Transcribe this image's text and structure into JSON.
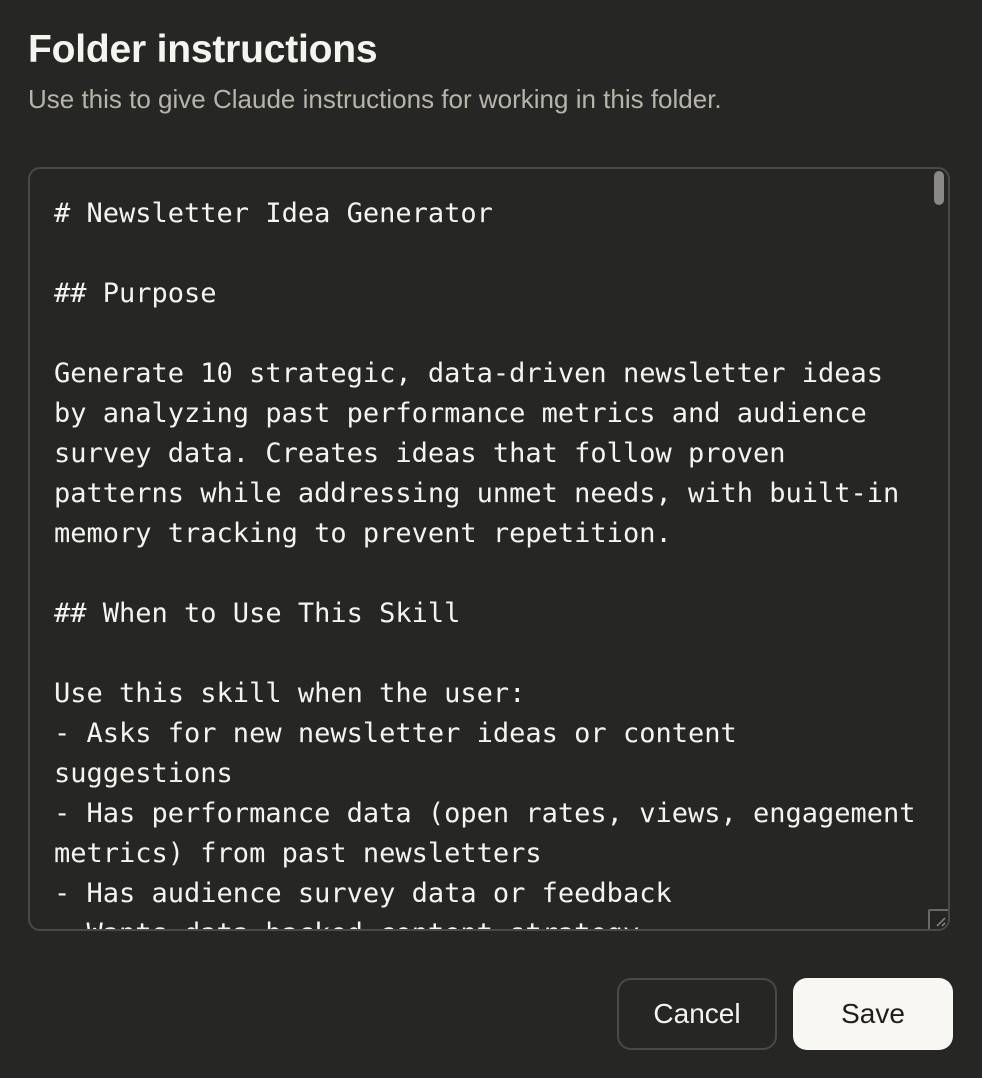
{
  "dialog": {
    "title": "Folder instructions",
    "subtitle": "Use this to give Claude instructions for working in this folder."
  },
  "editor": {
    "value": "# Newsletter Idea Generator\n\n## Purpose\n\nGenerate 10 strategic, data-driven newsletter ideas by analyzing past performance metrics and audience survey data. Creates ideas that follow proven patterns while addressing unmet needs, with built-in memory tracking to prevent repetition.\n\n## When to Use This Skill\n\nUse this skill when the user:\n- Asks for new newsletter ideas or content suggestions\n- Has performance data (open rates, views, engagement metrics) from past newsletters\n- Has audience survey data or feedback\n- Wants data-backed content strategy"
  },
  "actions": {
    "cancel_label": "Cancel",
    "save_label": "Save"
  },
  "colors": {
    "background": "#262624",
    "text_primary": "#f5f4ef",
    "text_secondary": "#b7b5a9",
    "border": "#4a4946",
    "save_button_bg": "#f8f7f2",
    "save_button_text": "#1f1e1d"
  }
}
